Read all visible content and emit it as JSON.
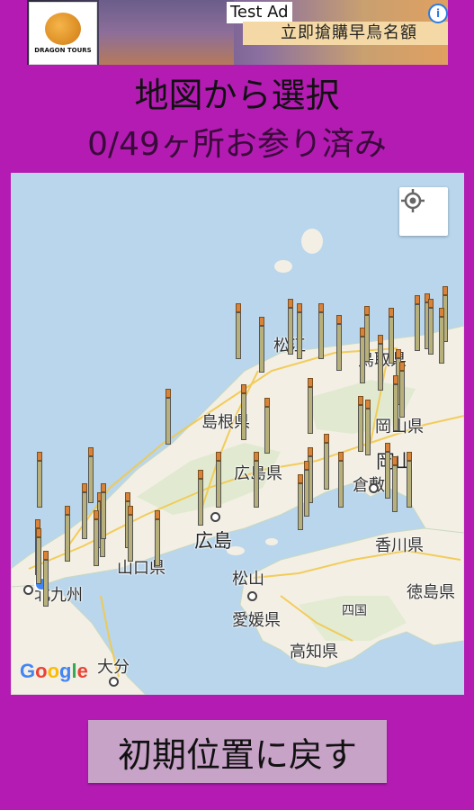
{
  "ad": {
    "tag": "Test Ad",
    "headline": "立即搶購早鳥名額",
    "logo_text": "DRAGON TOURS",
    "info_icon": "info-icon",
    "close_icon": "close-icon"
  },
  "header": {
    "title": "地図から選択",
    "progress": "0/49ヶ所お参り済み"
  },
  "map": {
    "labels": {
      "matsue": "松江",
      "tottori": "鳥取県",
      "shimane": "島根県",
      "okayama_pref": "岡山県",
      "hiroshima_pref": "広島県",
      "okayama": "岡山",
      "kurashiki": "倉敷",
      "hiroshima": "広島",
      "yamaguchi": "山口県",
      "kagawa": "香川県",
      "matsuyama": "松山",
      "kitakyushu": "北九州",
      "tokushima": "徳島県",
      "ehime": "愛媛県",
      "shikoku": "四国",
      "kochi": "高知県",
      "oita": "大分"
    },
    "attribution": "Google",
    "my_location_icon": "crosshair-icon",
    "marker_count": 49
  },
  "footer": {
    "reset_label": "初期位置に戻す"
  },
  "colors": {
    "background": "#b31bb3",
    "button": "#c8a3c8",
    "sea": "#b9d6ec",
    "land": "#f3efe4",
    "marker_pole": "#b8b07a",
    "marker_cap": "#d9823a"
  }
}
